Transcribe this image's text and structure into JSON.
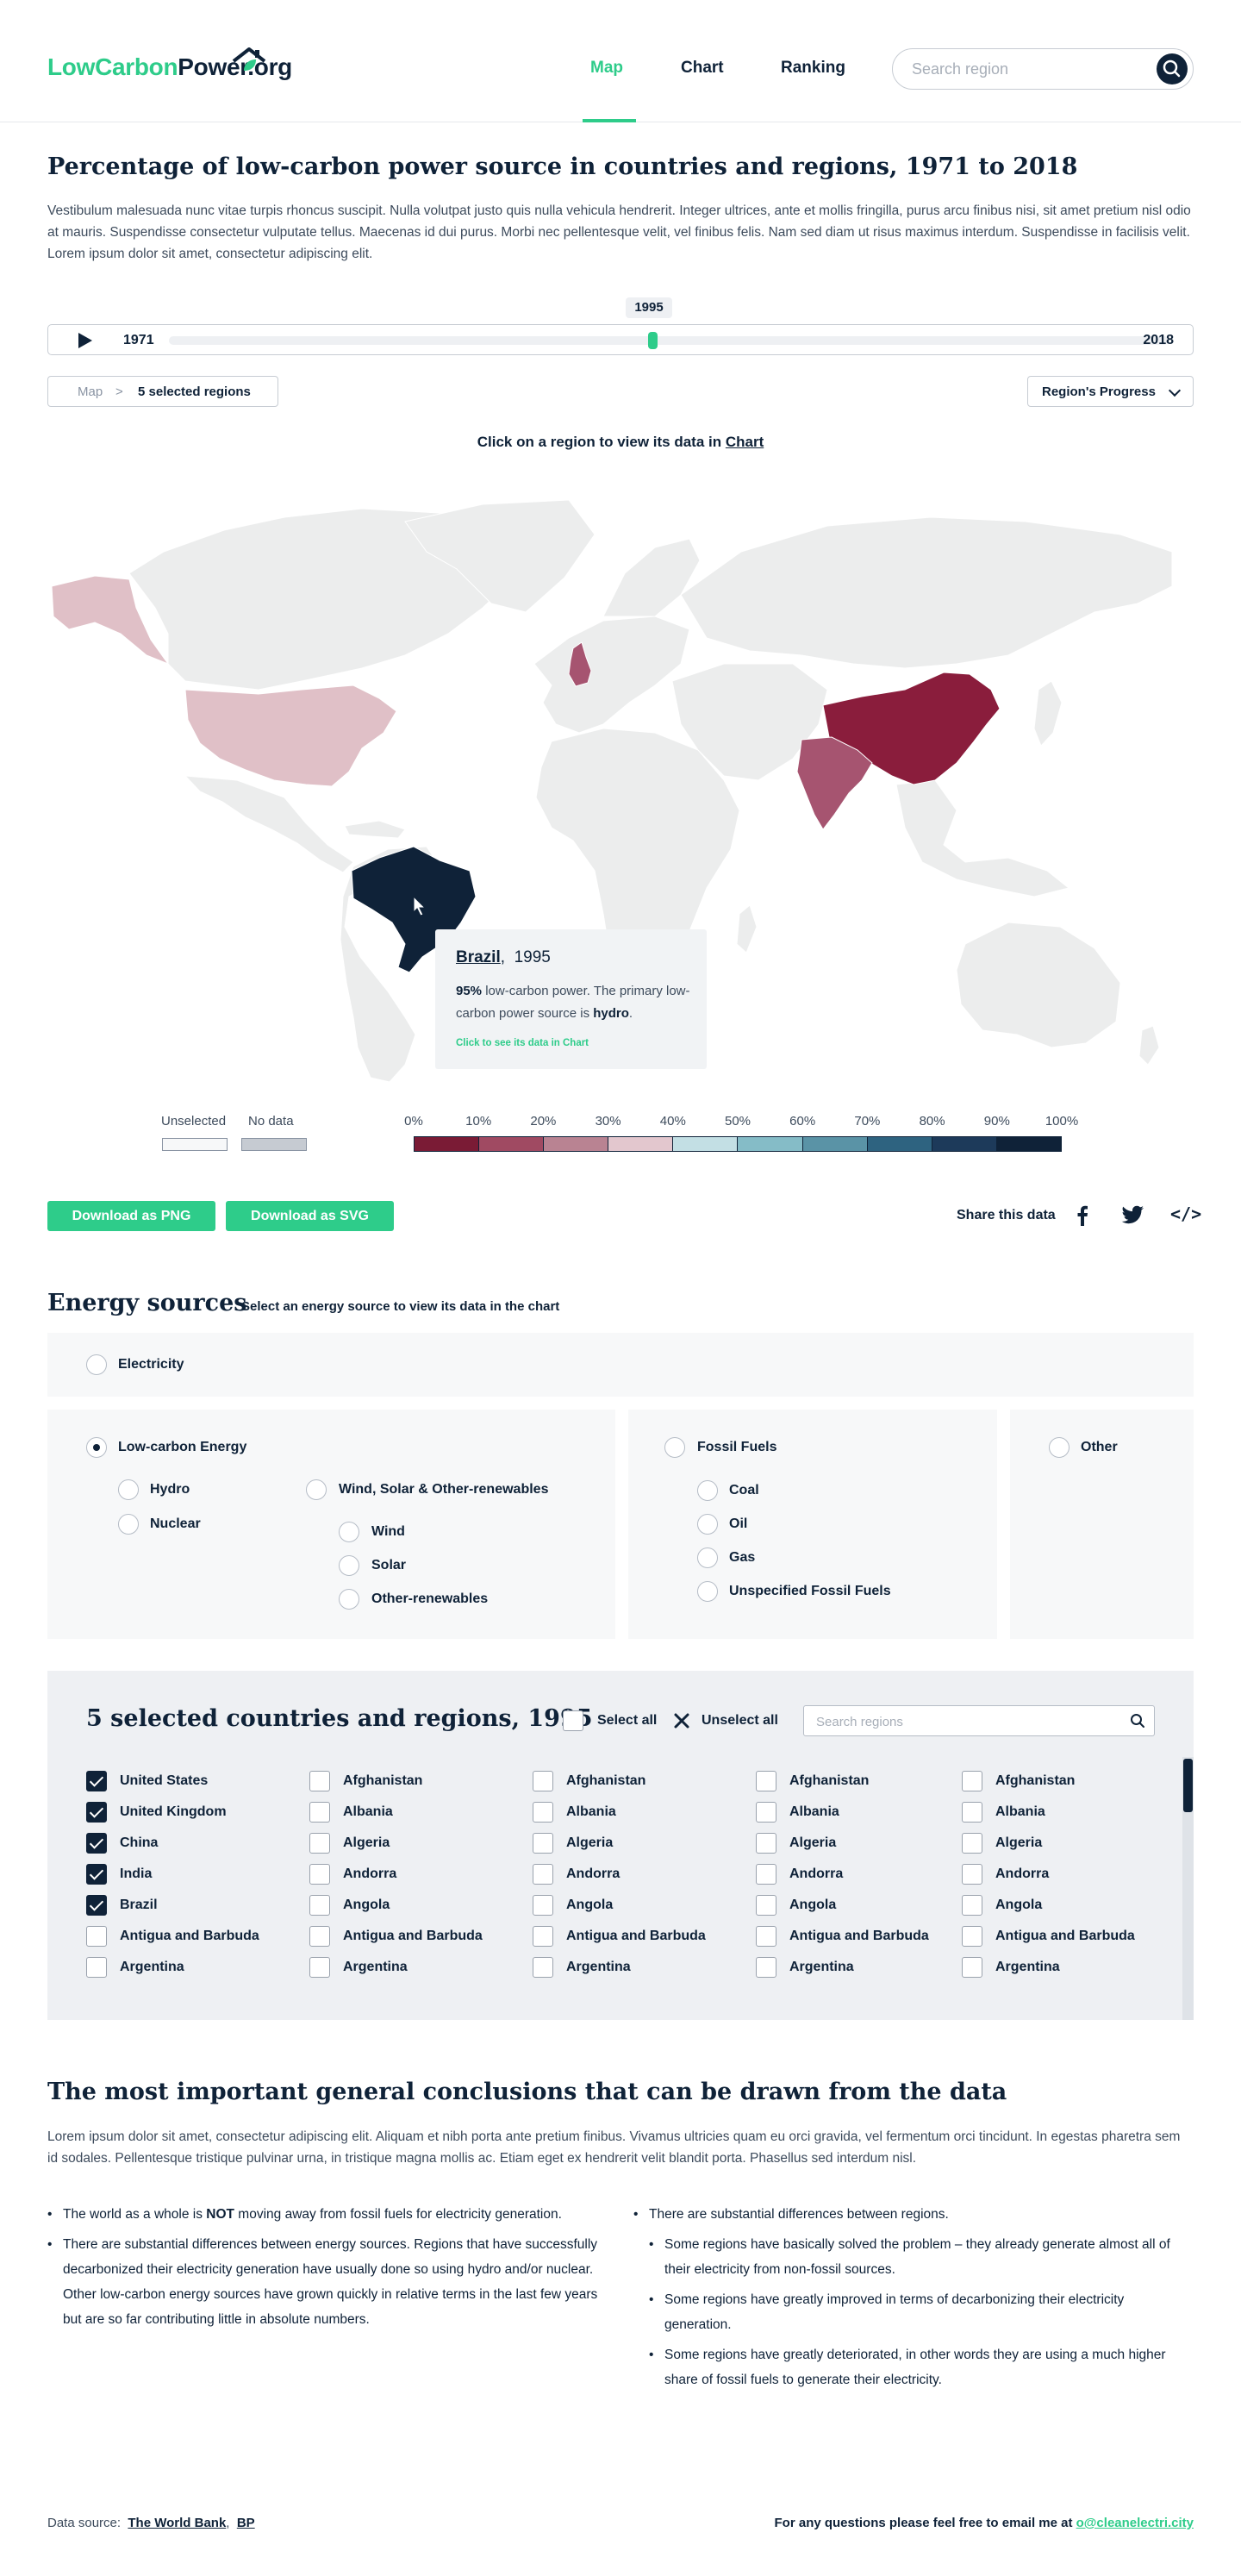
{
  "header": {
    "logo_green": "LowCarbon",
    "logo_dark": "Power",
    "logo_suffix": ".org",
    "nav": [
      "Map",
      "Chart",
      "Ranking"
    ],
    "active_nav": "Map",
    "search_placeholder": "Search region",
    "colors": {
      "accent": "#2ecc8a",
      "navy": "#0f2238"
    }
  },
  "intro": {
    "title": "Percentage of low-carbon power source in countries and regions, 1971 to 2018",
    "text": "Vestibulum malesuada nunc vitae turpis rhoncus suscipit. Nulla volutpat justo quis nulla vehicula hendrerit. Integer ultrices, ante et mollis fringilla, purus arcu finibus nisi, sit amet pretium nisl odio at mauris. Suspendisse consectetur vulputate tellus. Maecenas id dui purus. Morbi nec pellentesque velit, vel finibus felis. Nam sed diam ut risus maximus interdum. Suspendisse in facilisis velit. Lorem ipsum dolor sit amet, consectetur adipiscing elit."
  },
  "timeline": {
    "start": "1971",
    "end": "2018",
    "current": "1995",
    "progress": 0.51
  },
  "breadcrumb": {
    "root": "Map",
    "separator": ">",
    "current": "5 selected regions"
  },
  "view_select": {
    "selected": "Region's Progress"
  },
  "map": {
    "hint_prefix": "Click on a region to view its data in ",
    "hint_link": "Chart",
    "tooltip": {
      "region": "Brazil",
      "separator": ",",
      "year": "1995",
      "percent": "95%",
      "text_a": " low-carbon power. The primary low-carbon power source is ",
      "source": "hydro",
      "text_b": ".",
      "link": "Click to see its data in Chart"
    },
    "regions": [
      {
        "name": "Brazil",
        "color": "#0f2238"
      },
      {
        "name": "China",
        "color": "#8a1d3c"
      },
      {
        "name": "India",
        "color": "#a65470"
      },
      {
        "name": "United States",
        "color": "#e0c0c7"
      },
      {
        "name": "United Kingdom",
        "color": "#a65470"
      }
    ]
  },
  "legend": {
    "unselected": "Unselected",
    "no_data": "No data",
    "ticks": [
      "0%",
      "10%",
      "20%",
      "30%",
      "40%",
      "50%",
      "60%",
      "70%",
      "80%",
      "90%",
      "100%"
    ],
    "colors": [
      "#7a1b35",
      "#a04a62",
      "#b98392",
      "#e3c7ce",
      "#c3dfe4",
      "#85bcc7",
      "#5a93a6",
      "#2e6380",
      "#1d3a5a",
      "#0f2238"
    ]
  },
  "actions": {
    "download_png": "Download as PNG",
    "download_svg": "Download as SVG",
    "share_label": "Share this data",
    "embed_symbol": "</>"
  },
  "energy": {
    "title": "Energy sources",
    "subtitle": "Select an energy source to view its data in the chart",
    "electricity": "Electricity",
    "low_carbon": "Low-carbon Energy",
    "hydro": "Hydro",
    "nuclear": "Nuclear",
    "wind_solar_other": "Wind, Solar & Other-renewables",
    "wind": "Wind",
    "solar": "Solar",
    "other_renewables": "Other-renewables",
    "fossil": "Fossil Fuels",
    "coal": "Coal",
    "oil": "Oil",
    "gas": "Gas",
    "unspecified_fossil": "Unspecified Fossil Fuels",
    "other": "Other",
    "selected": "Low-carbon Energy"
  },
  "selection": {
    "title": "5 selected countries and regions, 1995",
    "select_all": "Select all",
    "unselect_all": "Unselect all",
    "search_placeholder": "Search regions",
    "columns": [
      [
        {
          "name": "United States",
          "checked": true
        },
        {
          "name": "United Kingdom",
          "checked": true
        },
        {
          "name": "China",
          "checked": true
        },
        {
          "name": "India",
          "checked": true
        },
        {
          "name": "Brazil",
          "checked": true
        },
        {
          "name": "Antigua and Barbuda",
          "checked": false
        },
        {
          "name": "Argentina",
          "checked": false
        }
      ],
      [
        {
          "name": "Afghanistan",
          "checked": false
        },
        {
          "name": "Albania",
          "checked": false
        },
        {
          "name": "Algeria",
          "checked": false
        },
        {
          "name": "Andorra",
          "checked": false
        },
        {
          "name": "Angola",
          "checked": false
        },
        {
          "name": "Antigua and Barbuda",
          "checked": false
        },
        {
          "name": "Argentina",
          "checked": false
        }
      ],
      [
        {
          "name": "Afghanistan",
          "checked": false
        },
        {
          "name": "Albania",
          "checked": false
        },
        {
          "name": "Algeria",
          "checked": false
        },
        {
          "name": "Andorra",
          "checked": false
        },
        {
          "name": "Angola",
          "checked": false
        },
        {
          "name": "Antigua and Barbuda",
          "checked": false
        },
        {
          "name": "Argentina",
          "checked": false
        }
      ],
      [
        {
          "name": "Afghanistan",
          "checked": false
        },
        {
          "name": "Albania",
          "checked": false
        },
        {
          "name": "Algeria",
          "checked": false
        },
        {
          "name": "Andorra",
          "checked": false
        },
        {
          "name": "Angola",
          "checked": false
        },
        {
          "name": "Antigua and Barbuda",
          "checked": false
        },
        {
          "name": "Argentina",
          "checked": false
        }
      ],
      [
        {
          "name": "Afghanistan",
          "checked": false
        },
        {
          "name": "Albania",
          "checked": false
        },
        {
          "name": "Algeria",
          "checked": false
        },
        {
          "name": "Andorra",
          "checked": false
        },
        {
          "name": "Angola",
          "checked": false
        },
        {
          "name": "Antigua and Barbuda",
          "checked": false
        },
        {
          "name": "Argentina",
          "checked": false
        }
      ]
    ]
  },
  "conclusions": {
    "title": "The most important general conclusions that can be drawn from the data",
    "intro": "Lorem ipsum dolor sit amet, consectetur adipiscing elit. Aliquam et nibh porta ante pretium finibus. Vivamus ultricies quam eu orci gravida, vel fermentum orci tincidunt. In egestas pharetra sem id sodales. Pellentesque tristique pulvinar urna, in tristique magna mollis ac. Etiam eget ex hendrerit velit blandit porta. Phasellus sed interdum nisl.",
    "left_1_a": "The world as a whole is ",
    "left_1_b": "NOT",
    "left_1_c": " moving away from fossil fuels for electricity generation.",
    "left_2": "There are substantial differences between energy sources. Regions that have successfully decarbonized their electricity generation have usually done so using hydro and/or nuclear. Other low-carbon energy sources have grown quickly in relative terms in the last few years but are so far contributing little in absolute numbers.",
    "right_1": "There are substantial differences between regions.",
    "right_2": "Some regions have basically solved the problem – they already generate almost all of their electricity from non-fossil sources.",
    "right_3": "Some regions have greatly improved in terms of decarbonizing their electricity generation.",
    "right_4": "Some regions have greatly deteriorated, in other words they are using a much higher share of fossil fuels to generate their electricity."
  },
  "footer": {
    "data_source_label": "Data source:",
    "source_1": "The World Bank",
    "source_sep": ",",
    "source_2": "BP",
    "contact_text": "For any questions please feel free to email me at ",
    "contact_email": "o@cleanelectri.city"
  }
}
